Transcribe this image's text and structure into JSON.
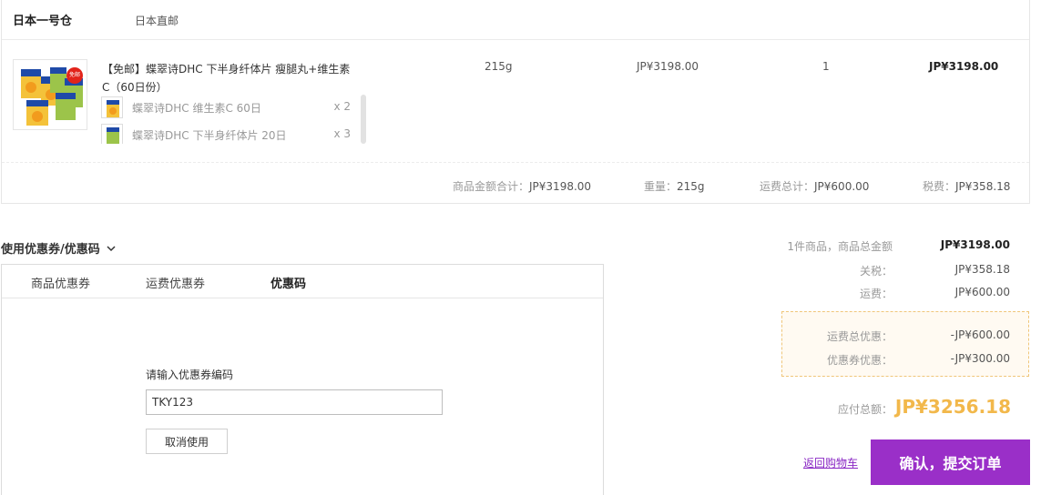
{
  "warehouse": {
    "name": "日本一号仓",
    "shipping": "日本直邮"
  },
  "product": {
    "badge": "免邮",
    "title": "【免邮】蝶翠诗DHC 下半身纤体片 瘦腿丸+维生素C（60日份）",
    "weight": "215g",
    "price": "JP¥3198.00",
    "qty": "1",
    "subtotal": "JP¥3198.00",
    "items": [
      {
        "name": "蝶翠诗DHC 维生素C 60日",
        "qty": "x 2"
      },
      {
        "name": "蝶翠诗DHC 下半身纤体片 20日",
        "qty": "x 3"
      }
    ]
  },
  "summary": {
    "goods_label": "商品金额合计：",
    "goods_value": "JP¥3198.00",
    "weight_label": "重量：",
    "weight_value": "215g",
    "shipping_label": "运费总计：",
    "shipping_value": "JP¥600.00",
    "tax_label": "税费：",
    "tax_value": "JP¥358.18"
  },
  "coupon": {
    "toggle": "使用优惠券/优惠码",
    "tabs": [
      "商品优惠券",
      "运费优惠券",
      "优惠码"
    ],
    "code_label": "请输入优惠券编码",
    "code_value": "TKY123",
    "cancel": "取消使用"
  },
  "totals": {
    "count_label": "1件商品，商品总金额",
    "count_value": "JP¥3198.00",
    "duty_label": "关税：",
    "duty_value": "JP¥358.18",
    "freight_label": "运费：",
    "freight_value": "JP¥600.00",
    "freight_discount_label": "运费总优惠：",
    "freight_discount_value": "-JP¥600.00",
    "coupon_discount_label": "优惠券优惠：",
    "coupon_discount_value": "-JP¥300.00",
    "grand_label": "应付总额：",
    "grand_value": "JP¥3256.18"
  },
  "actions": {
    "back": "返回购物车",
    "submit": "确认，提交订单"
  },
  "colors": {
    "accent": "#9a2fc8",
    "price_highlight": "#f2b84b",
    "badge": "#e2231a"
  }
}
